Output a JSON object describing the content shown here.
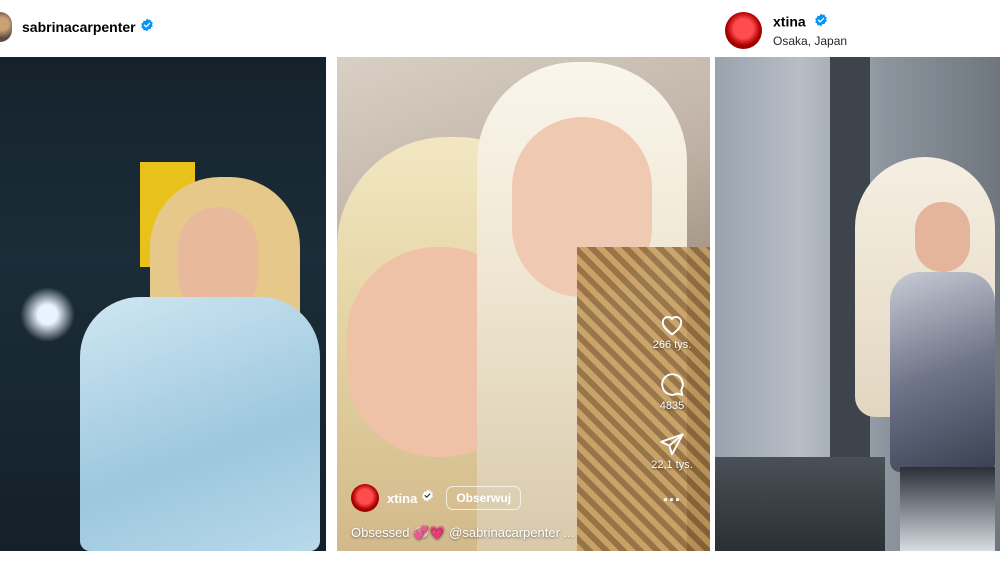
{
  "posts": [
    {
      "username": "sabrinacarpenter",
      "verified": true,
      "image_alt_icon": "photo"
    },
    {
      "type": "reel",
      "username": "xtina",
      "verified": true,
      "follow_label": "Obserwuj",
      "caption_text": "Obsessed 💞💗 ",
      "caption_mention": "@sabrinacarpenter ...",
      "actions": {
        "likes": "266 tys.",
        "comments": "4835",
        "shares": "22,1 tys."
      },
      "more_label": "..."
    },
    {
      "username": "xtina",
      "verified": true,
      "location": "Osaka, Japan"
    }
  ],
  "colors": {
    "verified_blue": "#0095f6",
    "white": "#ffffff"
  }
}
